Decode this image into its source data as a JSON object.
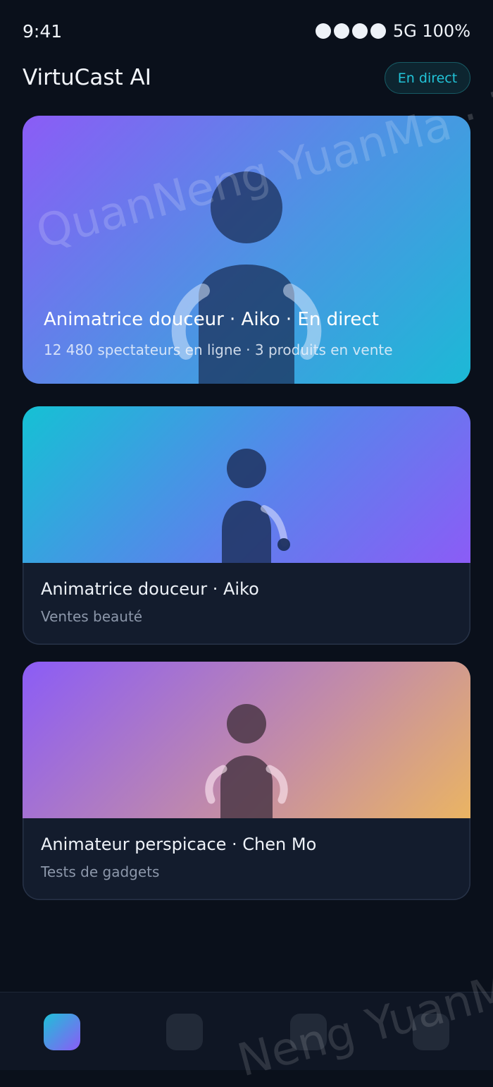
{
  "status_bar": {
    "time": "9:41",
    "network": "5G 100%"
  },
  "header": {
    "app_title": "VirtuCast AI",
    "live_label": "En direct"
  },
  "hero": {
    "title": "Animatrice douceur · Aiko · En direct",
    "subtitle": "12 480 spectateurs en ligne · 3 produits en vente"
  },
  "hosts": [
    {
      "title": "Animatrice douceur · Aiko",
      "subtitle": "Ventes beauté"
    },
    {
      "title": "Animateur perspicace · Chen Mo",
      "subtitle": "Tests de gadgets"
    }
  ],
  "watermark": [
    "QuanNeng YuanMa · i",
    "Neng YuanMa"
  ],
  "colors": {
    "accent": "#22c4d8",
    "purple": "#8b5cf6",
    "background": "#0a101b",
    "card": "#131c2d"
  },
  "nav": {
    "icons": [
      "home-icon",
      "nav-icon-2",
      "nav-icon-3",
      "nav-icon-4"
    ]
  }
}
